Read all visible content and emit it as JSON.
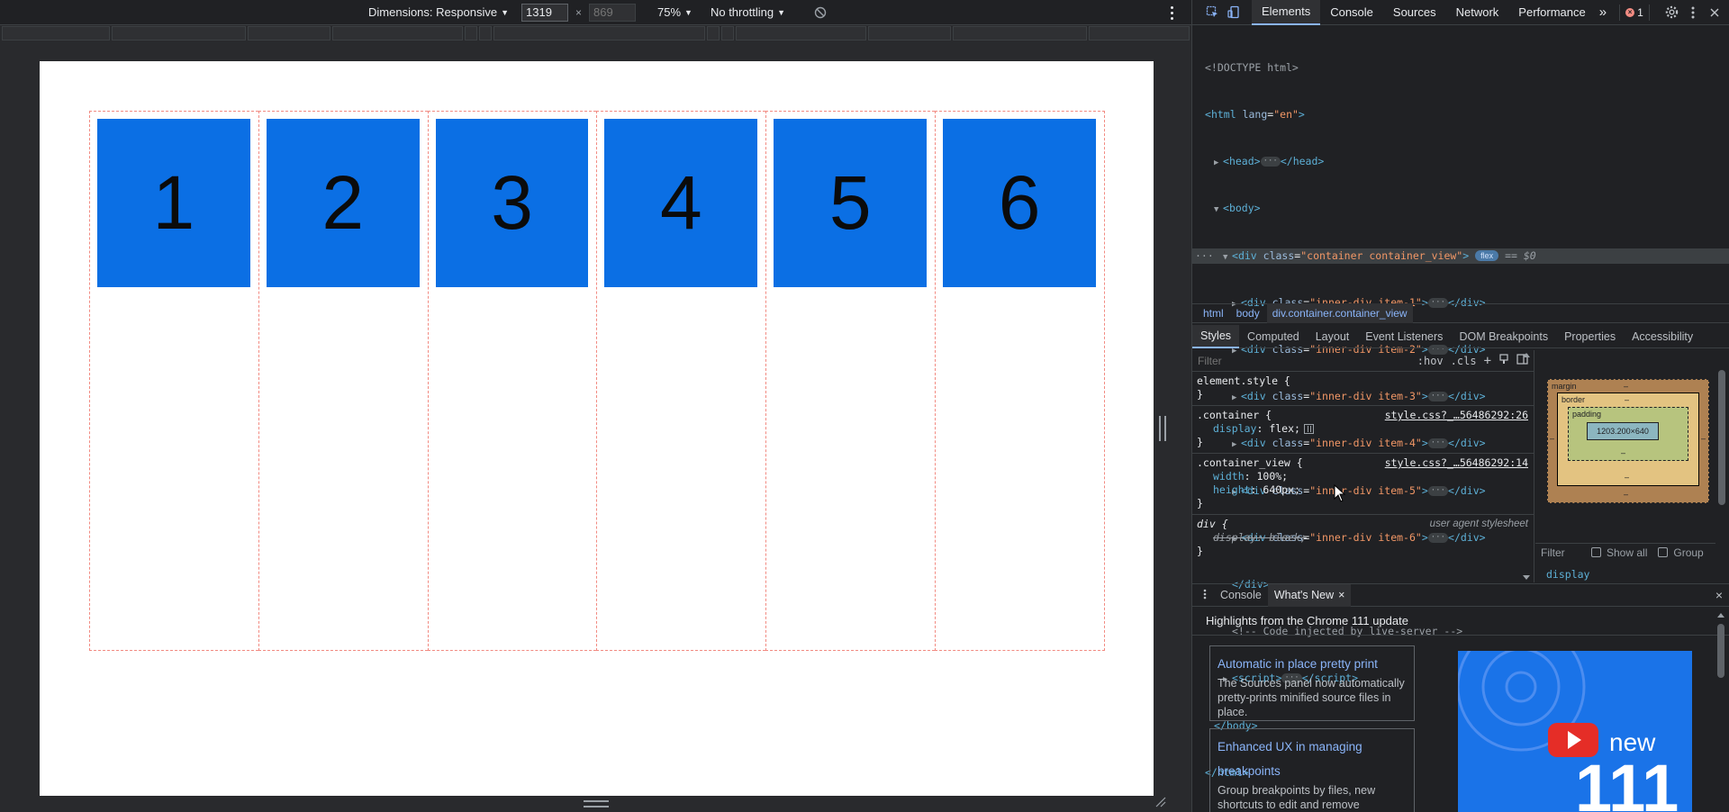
{
  "device_toolbar": {
    "dimensions_label": "Dimensions: Responsive",
    "width_value": "1319",
    "height_placeholder": "869",
    "times": "×",
    "zoom": "75%",
    "throttling": "No throttling"
  },
  "page": {
    "items": [
      "1",
      "2",
      "3",
      "4",
      "5",
      "6"
    ],
    "item_color": "#0b6fe4"
  },
  "devtools": {
    "tabs": [
      "Elements",
      "Console",
      "Sources",
      "Network",
      "Performance"
    ],
    "more_tabs": "»",
    "error_count": "1",
    "dom": {
      "doctype": "<!DOCTYPE html>",
      "html_open": "html",
      "html_attr_name": "lang",
      "html_attr_val": "\"en\"",
      "head": "head",
      "body": "body",
      "container_tag": "div",
      "container_class_attr": "class",
      "container_class_val": "\"container container_view\"",
      "flex_badge": "flex",
      "dollar": "== $0",
      "children": [
        {
          "cls": "\"inner-div item-1\""
        },
        {
          "cls": "\"inner-div item-2\""
        },
        {
          "cls": "\"inner-div item-3\""
        },
        {
          "cls": "\"inner-div item-4\""
        },
        {
          "cls": "\"inner-div item-5\""
        },
        {
          "cls": "\"inner-div item-6\""
        }
      ],
      "comment": "<!-- Code injected by live-server -->",
      "script": "script"
    },
    "breadcrumbs": [
      "html",
      "body",
      "div.container.container_view"
    ],
    "sub_tabs": [
      "Styles",
      "Computed",
      "Layout",
      "Event Listeners",
      "DOM Breakpoints",
      "Properties",
      "Accessibility"
    ],
    "styles": {
      "filter_placeholder": "Filter",
      "hov": ":hov",
      "cls": ".cls",
      "rules": {
        "element_style": "element.style {",
        "container_sel": ".container {",
        "container_src": "style.css?_…56486292:26",
        "display_name": "display",
        "display_value": "flex;",
        "container_view_sel": ".container_view {",
        "container_view_src": "style.css?_…56486292:14",
        "width_name": "width",
        "width_value": "100%;",
        "height_name": "height",
        "height_value": "640px;",
        "div_sel": "div {",
        "ua_src": "user agent stylesheet",
        "ua_display": "display: block;",
        "close": "}"
      }
    },
    "computed": {
      "margin_label": "margin",
      "border_label": "border",
      "padding_label": "padding",
      "dash": "–",
      "content_size": "1203.200×640",
      "filter": "Filter",
      "show_all": "Show all",
      "group": "Group",
      "display_prop": "display"
    },
    "drawer": {
      "tabs": [
        "Console",
        "What's New"
      ],
      "close_x": "×",
      "headline": "Highlights from the Chrome 111 update",
      "card1_title": "Automatic in place pretty print",
      "card1_desc": "The Sources panel now automatically pretty-prints minified source files in place.",
      "card2_title": "Enhanced UX in managing breakpoints",
      "card2_desc": "Group breakpoints by files, new shortcuts to edit and remove breakpoints and more.",
      "video_new": "new",
      "video_number": "111"
    }
  }
}
